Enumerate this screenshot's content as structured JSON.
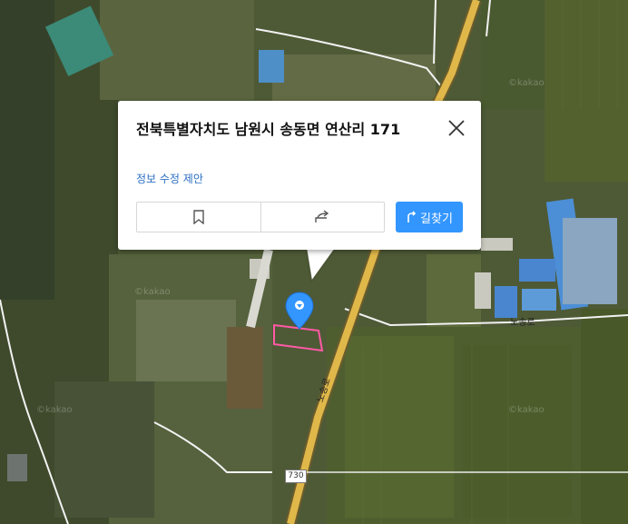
{
  "popup": {
    "address": "전북특별자치도 남원시 송동면 연산리 171",
    "edit_suggestion": "정보 수정 제안",
    "route_label": "길찾기"
  },
  "map": {
    "road_shield": "730",
    "road_label_right": "노송로",
    "road_label_vertical": "노송로",
    "watermarks": [
      "©kakao",
      "©kakao",
      "©kakao",
      "©kakao"
    ]
  },
  "colors": {
    "route_button": "#3396ff",
    "marker": "#3396ff",
    "parcel_outline": "#ff5aa5",
    "main_road": "#e0b84a",
    "link": "#2b6fc2"
  },
  "icons": [
    "close-icon",
    "bookmark-icon",
    "share-icon",
    "route-icon",
    "location-pin-icon"
  ]
}
